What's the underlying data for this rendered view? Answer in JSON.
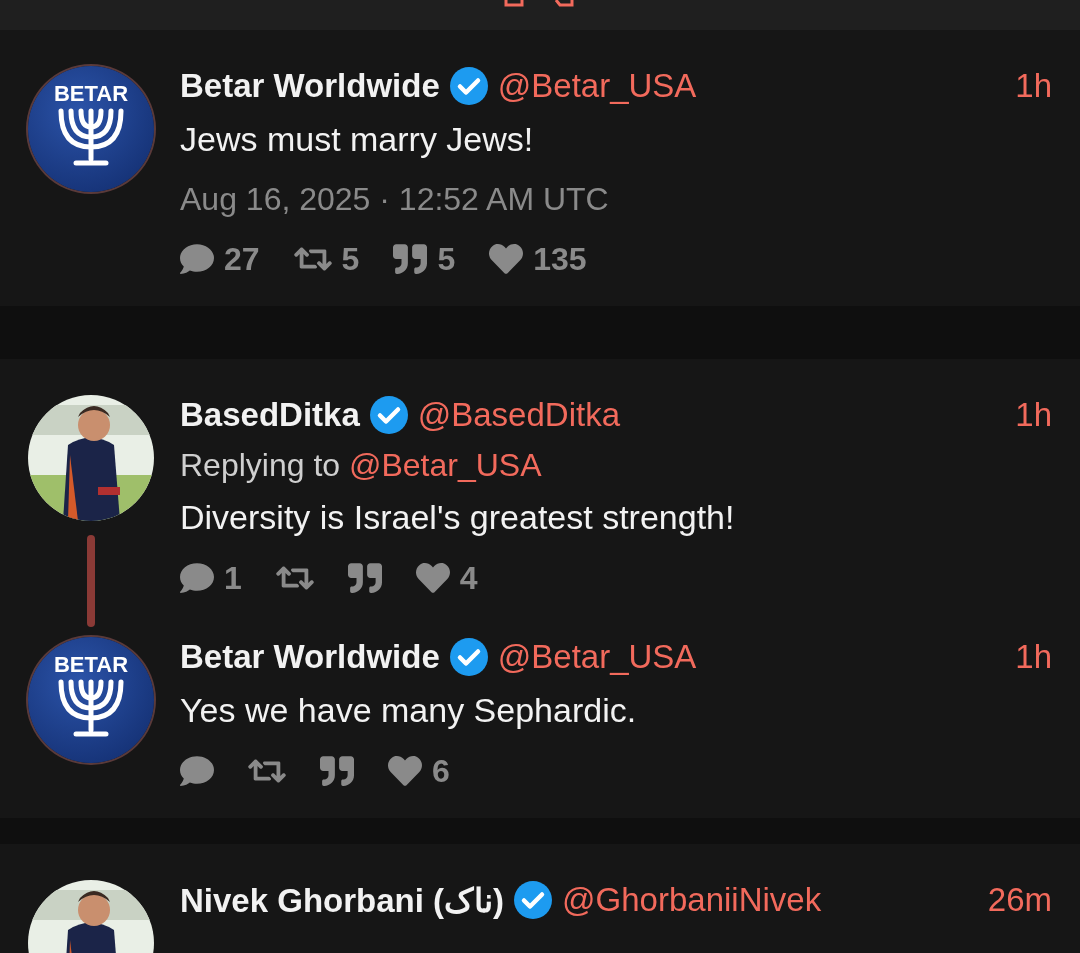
{
  "threads": [
    {
      "tweets": [
        {
          "avatar": {
            "kind": "logo",
            "text": "BETAR"
          },
          "name": "Betar Worldwide",
          "verified": true,
          "handle": "@Betar_USA",
          "time": "1h",
          "text": "Jews must marry Jews!",
          "date": "Aug 16, 2025 · 12:52 AM UTC",
          "stats": {
            "replies": "27",
            "retweets": "5",
            "quotes": "5",
            "likes": "135"
          }
        }
      ]
    },
    {
      "tweets": [
        {
          "name": "BasedDitka",
          "verified": true,
          "handle": "@BasedDitka",
          "time": "1h",
          "replying_label": "Replying to",
          "replying_to": "@Betar_USA",
          "text": "Diversity is Israel's greatest strength!",
          "stats": {
            "replies": "1",
            "likes": "4"
          }
        },
        {
          "avatar": {
            "kind": "logo",
            "text": "BETAR"
          },
          "name": "Betar Worldwide",
          "verified": true,
          "handle": "@Betar_USA",
          "time": "1h",
          "text": "Yes we have many Sephardic.",
          "stats": {
            "likes": "6"
          }
        }
      ]
    },
    {
      "tweets": [
        {
          "name": "Nivek Ghorbani (ناک)",
          "verified": true,
          "handle": "@GhorbaniiNivek",
          "time": "26m"
        }
      ]
    }
  ]
}
